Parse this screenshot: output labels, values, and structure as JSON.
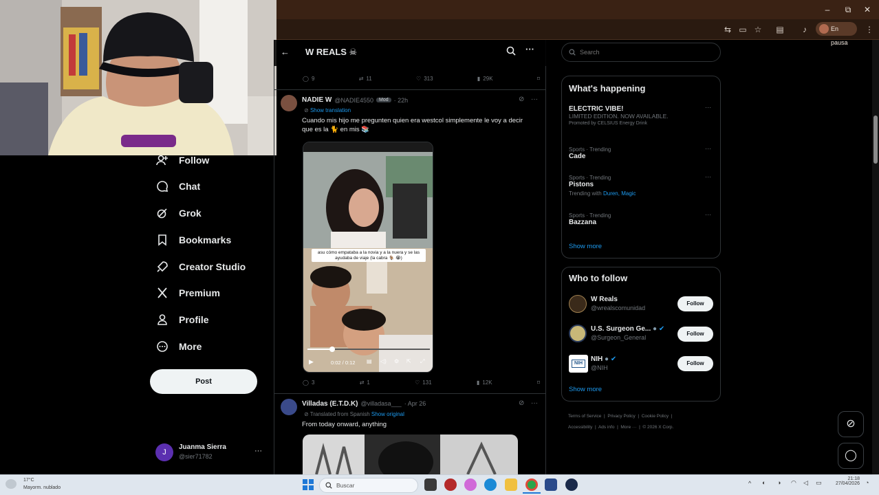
{
  "browser": {
    "minimize": "–",
    "restore": "⧉",
    "close": "✕",
    "paused_label": "En pausa",
    "accent": "#3a2214"
  },
  "nav": {
    "items": [
      {
        "label": "Follow",
        "icon": "person-add-icon"
      },
      {
        "label": "Chat",
        "icon": "chat-bubble-icon"
      },
      {
        "label": "Grok",
        "icon": "grok-icon"
      },
      {
        "label": "Bookmarks",
        "icon": "bookmark-icon"
      },
      {
        "label": "Creator Studio",
        "icon": "rocket-icon"
      },
      {
        "label": "Premium",
        "icon": "x-logo-icon"
      },
      {
        "label": "Profile",
        "icon": "person-icon"
      },
      {
        "label": "More",
        "icon": "more-circle-icon"
      }
    ],
    "post_label": "Post",
    "account": {
      "initial": "J",
      "name": "Juanma Sierra",
      "handle": "@sier71782",
      "more": "···"
    }
  },
  "main": {
    "header_title": "W REALS ☠",
    "prev_stats": {
      "replies": "9",
      "reposts": "11",
      "likes": "313",
      "views": "29K"
    },
    "tweet1": {
      "name": "NADIE W",
      "handle": "@NADIE4550",
      "badge": "Mod",
      "time": "· 22h",
      "translate": "Show translation",
      "text": "Cuando mis hijo me pregunten quien era westcol simplemente le voy a decir  que es la 🐈 en mis 📚",
      "caption": "asu cómo empataba a la novia y a la nuera y se las ayudaba de viaje (la cabra 🐐 😭)",
      "time_display": "0:02 / 0:12",
      "replies": "3",
      "reposts": "1",
      "likes": "131",
      "views": "12K"
    },
    "tweet2": {
      "name": "Villadas (E.T.D.K)",
      "handle": "@villadasa___",
      "time": "· Apr 26",
      "translated_note": "Translated from Spanish",
      "show_original": "Show original",
      "text": "From today onward, anything"
    }
  },
  "sidebar": {
    "search_placeholder": "Search",
    "happening_title": "What's happening",
    "trends": [
      {
        "meta": "",
        "name": "ELECTRIC VIBE!",
        "desc": "LIMITED EDITION. NOW AVAILABLE.",
        "promo": "Promoted by CELSIUS Energy Drink"
      },
      {
        "meta": "Sports · Trending",
        "name": "Cade",
        "desc": "",
        "promo": ""
      },
      {
        "meta": "Sports · Trending",
        "name": "Pistons",
        "desc": "Trending with",
        "promo": "Duren, Magic"
      },
      {
        "meta": "Sports · Trending",
        "name": "Bazzana",
        "desc": "",
        "promo": ""
      }
    ],
    "show_more": "Show more",
    "who_title": "Who to follow",
    "follows": [
      {
        "name": "W Reals",
        "handle": "@wrealscomunidad",
        "btn": "Follow"
      },
      {
        "name": "U.S. Surgeon Ge...",
        "handle": "@Surgeon_General",
        "btn": "Follow"
      },
      {
        "name": "NIH",
        "handle": "@NIH",
        "btn": "Follow"
      }
    ],
    "show_more_2": "Show more",
    "footer": [
      "Terms of Service",
      "Privacy Policy",
      "Cookie Policy",
      "Accessibility",
      "Ads info",
      "More ···",
      "© 2026 X Corp."
    ]
  },
  "taskbar": {
    "weather_temp": "17°C",
    "weather_desc": "Mayorm. nublado",
    "search_placeholder": "Buscar",
    "time": "21:18",
    "date": "27/04/2026"
  }
}
